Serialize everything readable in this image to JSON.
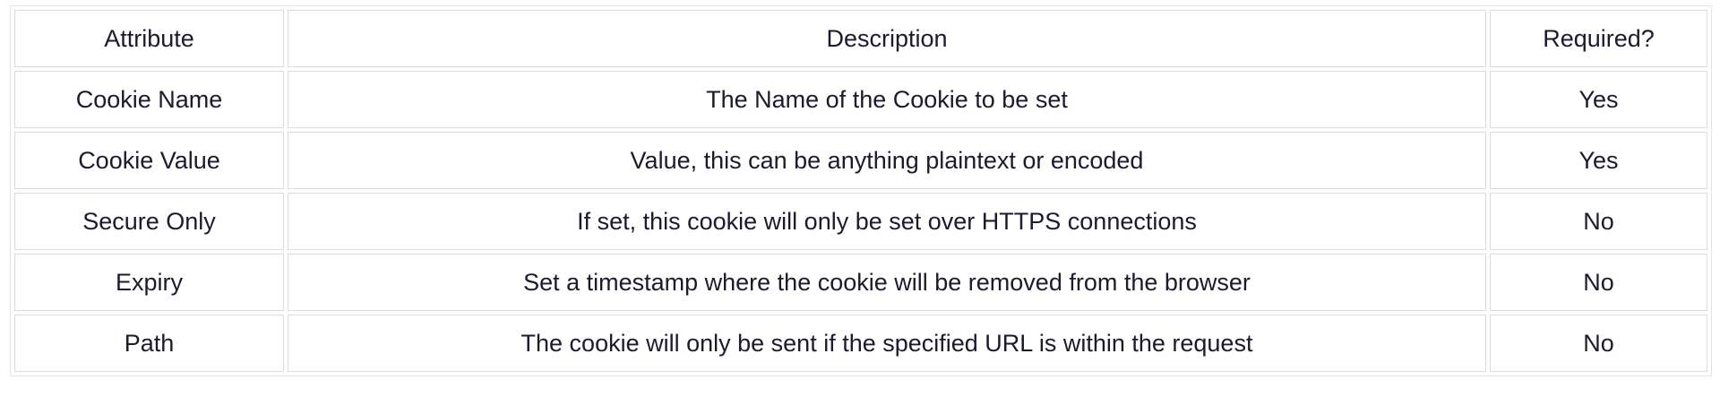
{
  "table": {
    "headers": [
      "Attribute",
      "Description",
      "Required?"
    ],
    "rows": [
      [
        "Cookie Name",
        "The Name of the Cookie to be set",
        "Yes"
      ],
      [
        "Cookie Value",
        "Value, this can be anything plaintext or encoded",
        "Yes"
      ],
      [
        "Secure Only",
        "If set, this cookie will only be set over HTTPS connections",
        "No"
      ],
      [
        "Expiry",
        "Set a timestamp where the cookie will be removed from the browser",
        "No"
      ],
      [
        "Path",
        "The cookie will only be sent if the specified URL is within the request",
        "No"
      ]
    ]
  }
}
